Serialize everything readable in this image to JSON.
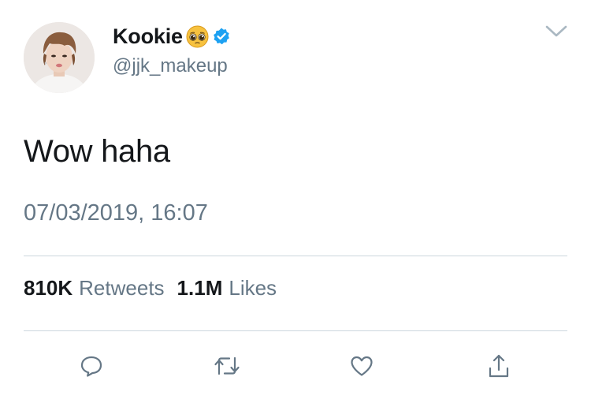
{
  "tweet": {
    "author": {
      "display_name": "Kookie",
      "handle": "@jjk_makeup",
      "avatar_icon": "profile-photo",
      "name_emoji_icon": "pleading-face-icon",
      "verified_icon": "verified-badge-icon"
    },
    "text": "Wow haha",
    "timestamp": "07/03/2019, 16:07",
    "stats": {
      "retweets_count": "810K",
      "retweets_label": "Retweets",
      "likes_count": "1.1M",
      "likes_label": "Likes"
    },
    "actions": [
      {
        "icon": "reply-icon"
      },
      {
        "icon": "retweet-icon"
      },
      {
        "icon": "like-icon"
      },
      {
        "icon": "share-icon"
      }
    ],
    "menu_icon": "chevron-down-icon"
  },
  "colors": {
    "text_primary": "#14171a",
    "text_secondary": "#657786",
    "verified_blue": "#1da1f2",
    "divider": "#ccd6dd",
    "emoji_yellow": "#f7c23f"
  }
}
